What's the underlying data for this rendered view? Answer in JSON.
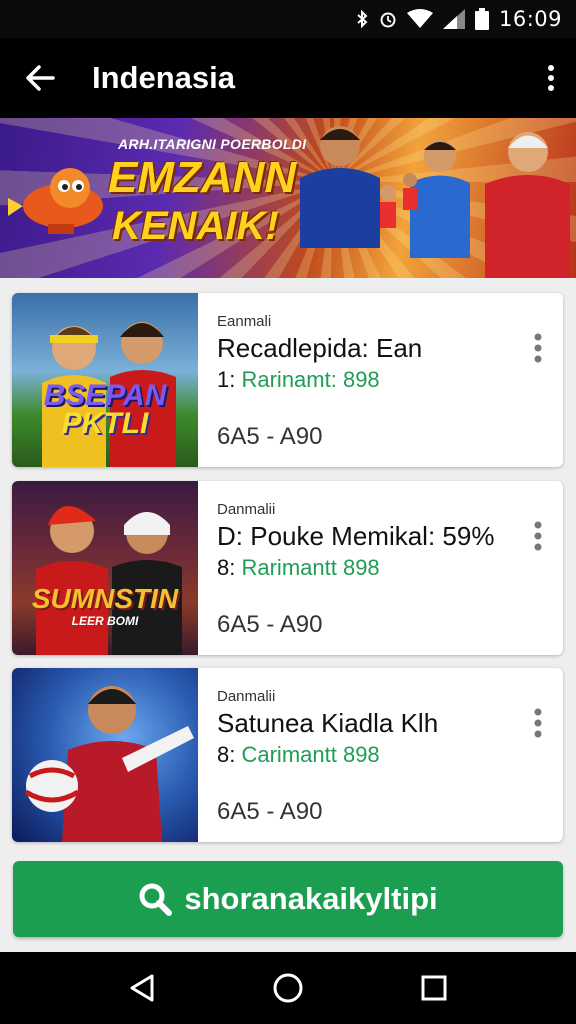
{
  "status": {
    "time": "16:09",
    "icons": [
      "bluetooth-icon",
      "alarm-icon",
      "wifi-icon",
      "signal-icon",
      "battery-icon"
    ]
  },
  "appbar": {
    "title": "Indenasia",
    "back_icon": "arrow-left-icon",
    "menu_icon": "more-vert-icon"
  },
  "banner": {
    "subtitle": "ARH.ITARIGNI POERBOLDI",
    "headline1": "EMZANN",
    "headline2": "KENAIK!"
  },
  "cards": [
    {
      "art_text": "PKTLI",
      "art_top": "BSEPAN",
      "meta": "Eanmali",
      "name": "Recadlepida: Ean",
      "rating_prefix": "1:",
      "rating_value": "Rarinamt: 898",
      "range": "6A5 - A90"
    },
    {
      "art_text": "SUMNSTIN",
      "art_top": "LEER BOMI",
      "meta": "Danmalii",
      "name": "D: Pouke Memikal: 59%",
      "rating_prefix": "8:",
      "rating_value": "Rarimantt 898",
      "range": "6A5 - A90"
    },
    {
      "art_text": "",
      "art_top": "",
      "meta": "Danmalii",
      "name": "Satunea Kiadla Klh",
      "rating_prefix": "8:",
      "rating_value": "Carimantt 898",
      "range": "6A5 - A90"
    }
  ],
  "search_button": {
    "label": "shoranakaikyltipi",
    "icon": "search-icon"
  },
  "navbar": {
    "icons": [
      "back-triangle-icon",
      "home-circle-icon",
      "recents-square-icon"
    ]
  },
  "colors": {
    "accent_green": "#1c9e50",
    "rating_green": "#1f9d55",
    "appbar": "#000000"
  }
}
